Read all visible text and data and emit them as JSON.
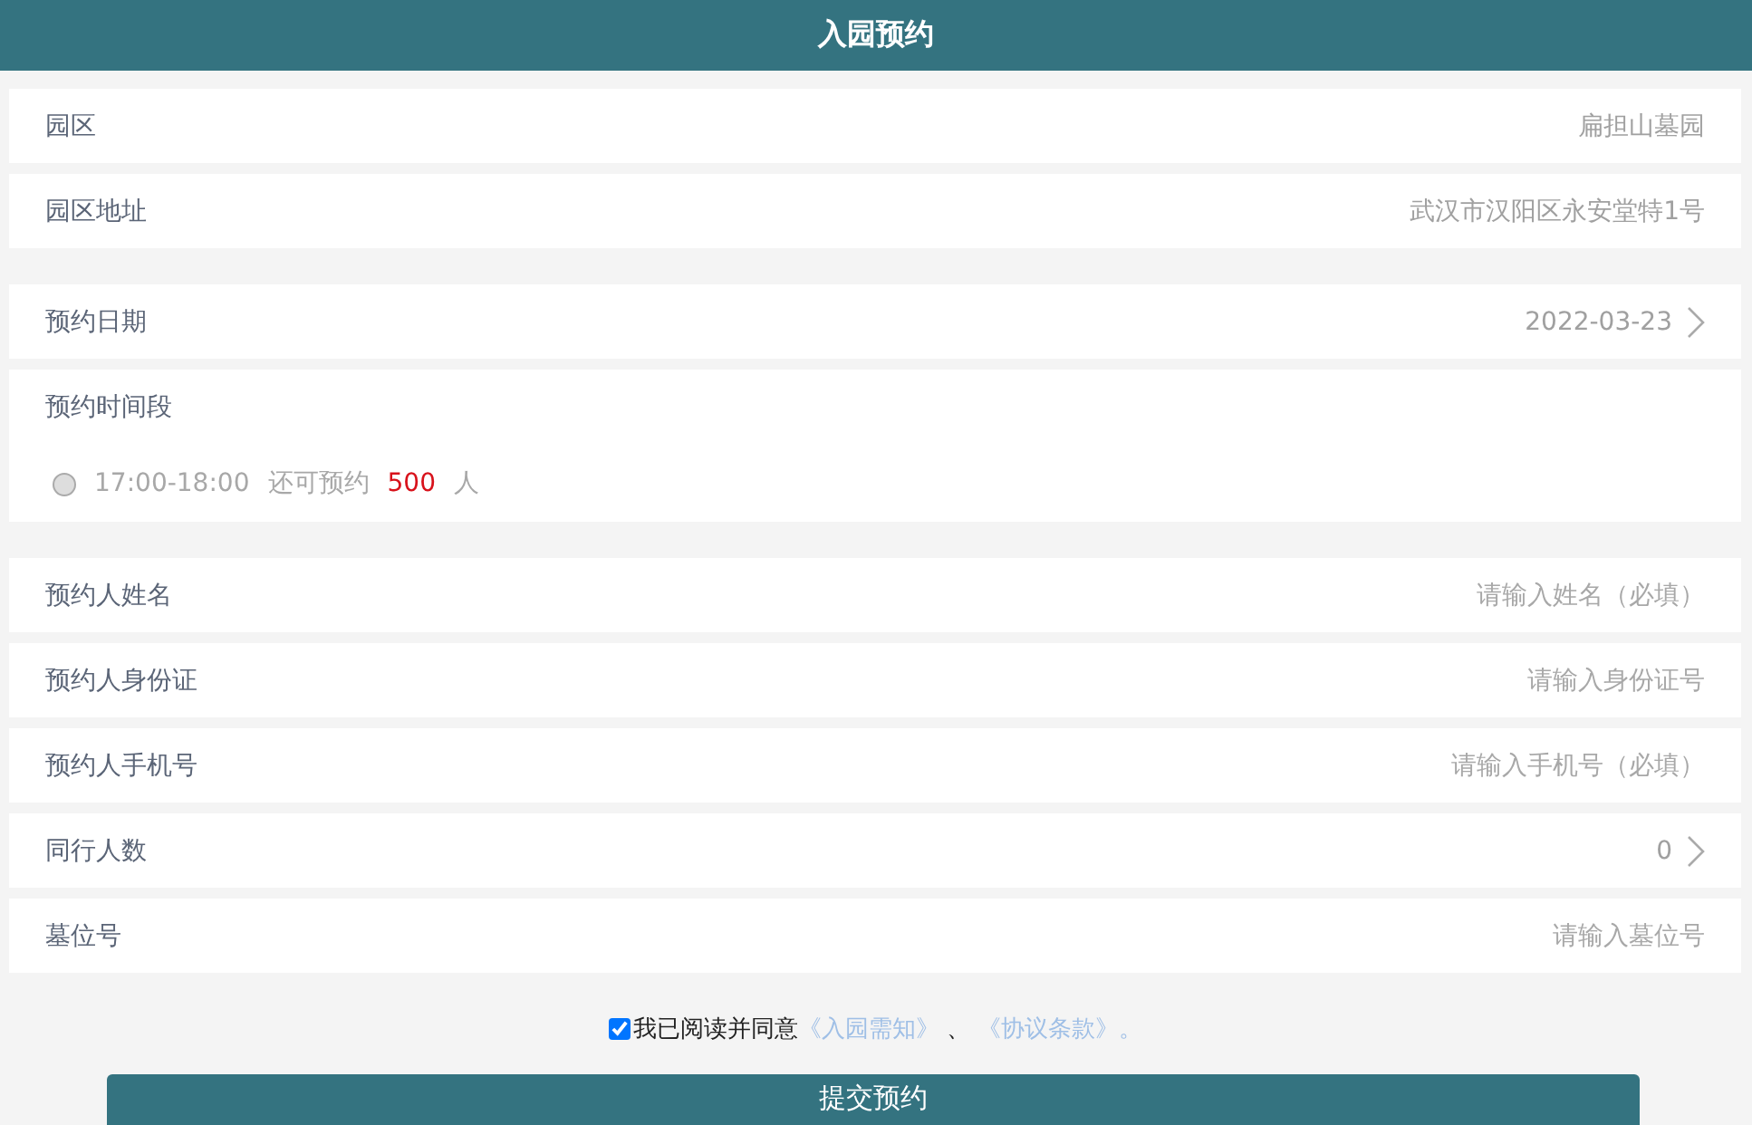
{
  "header": {
    "title": "入园预约"
  },
  "groups": [
    {
      "rows": [
        {
          "kind": "value",
          "label": "园区",
          "value": "扁担山墓园"
        },
        {
          "kind": "value",
          "label": "园区地址",
          "value": "武汉市汉阳区永安堂特1号"
        }
      ]
    },
    {
      "rows": [
        {
          "kind": "picker",
          "label": "预约日期",
          "value": "2022-03-23"
        },
        {
          "kind": "slots",
          "label": "预约时间段",
          "slots": [
            {
              "time": "17:00-18:00",
              "remaining_label": "还可预约",
              "remaining": "500",
              "unit": "人",
              "selected": false
            }
          ]
        }
      ]
    },
    {
      "rows": [
        {
          "kind": "input",
          "label": "预约人姓名",
          "placeholder": "请输入姓名（必填）"
        },
        {
          "kind": "input",
          "label": "预约人身份证",
          "placeholder": "请输入身份证号"
        },
        {
          "kind": "input",
          "label": "预约人手机号",
          "placeholder": "请输入手机号（必填）"
        },
        {
          "kind": "picker",
          "label": "同行人数",
          "value": "0"
        },
        {
          "kind": "input",
          "label": "墓位号",
          "placeholder": "请输入墓位号"
        }
      ]
    }
  ],
  "agreement": {
    "checked": true,
    "text": "我已阅读并同意",
    "links": [
      "《入园需知》",
      "《协议条款》"
    ],
    "separator": "、",
    "end": "。"
  },
  "submit": {
    "label": "提交预约"
  }
}
